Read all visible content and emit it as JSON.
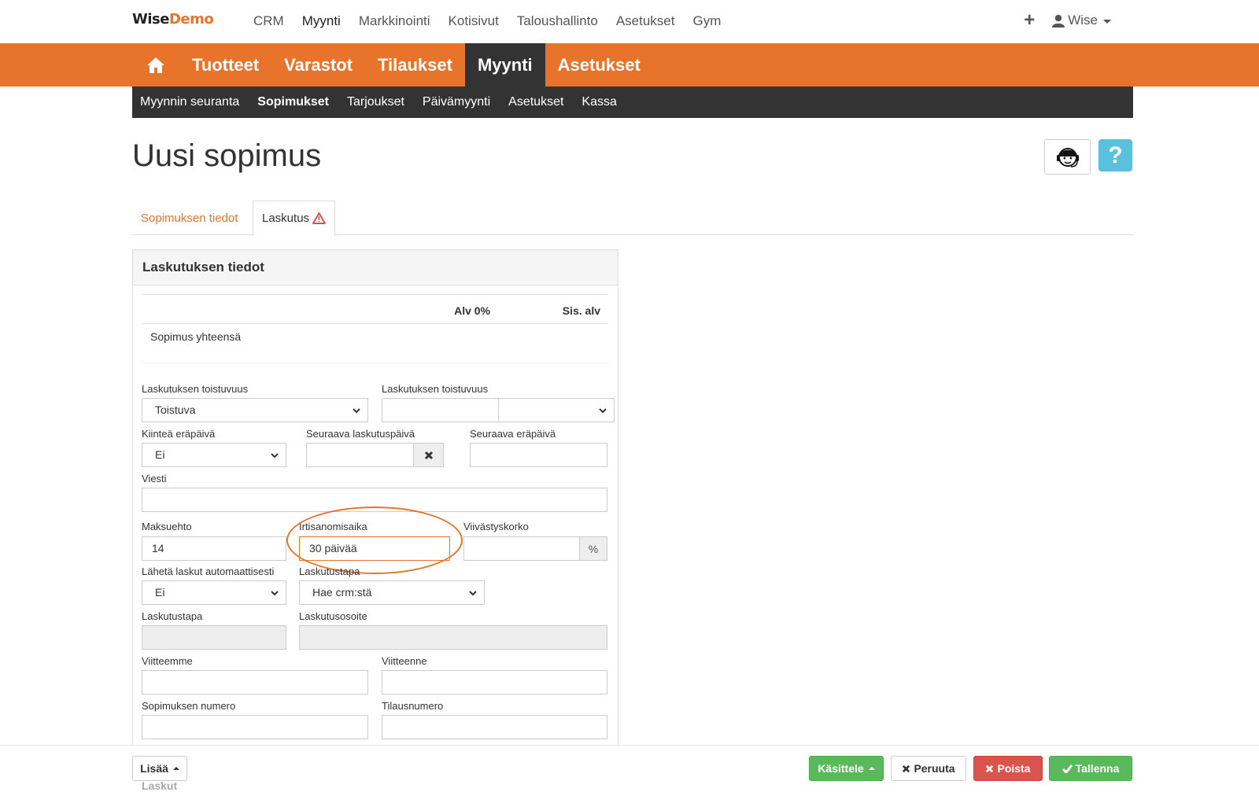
{
  "brand": {
    "part1": "Wise",
    "part2": "Demo",
    "accent": "#e8732b"
  },
  "top_nav": {
    "items": [
      {
        "label": "CRM"
      },
      {
        "label": "Myynti"
      },
      {
        "label": "Markkinointi"
      },
      {
        "label": "Kotisivut"
      },
      {
        "label": "Taloushallinto"
      },
      {
        "label": "Asetukset"
      },
      {
        "label": "Gym"
      }
    ],
    "active": "Myynti"
  },
  "user": {
    "name": "Wise",
    "icons": [
      "plus-icon",
      "user-icon",
      "chevron-down-icon"
    ]
  },
  "main_nav": {
    "items": [
      {
        "label": "Tuotteet"
      },
      {
        "label": "Varastot"
      },
      {
        "label": "Tilaukset"
      },
      {
        "label": "Myynti"
      },
      {
        "label": "Asetukset"
      }
    ],
    "active": "Myynti",
    "home_icon": "home-icon"
  },
  "sub_nav": {
    "items": [
      {
        "label": "Myynnin seuranta"
      },
      {
        "label": "Sopimukset"
      },
      {
        "label": "Tarjoukset"
      },
      {
        "label": "Päivämyynti"
      },
      {
        "label": "Asetukset"
      },
      {
        "label": "Kassa"
      }
    ],
    "active": "Sopimukset"
  },
  "page": {
    "title": "Uusi sopimus",
    "help": "?"
  },
  "tabs": [
    {
      "label": "Sopimuksen tiedot",
      "active": false
    },
    {
      "label": "Laskutus",
      "active": true,
      "warning_icon": "warning-icon"
    }
  ],
  "panel": {
    "title": "Laskutuksen tiedot",
    "summary": {
      "col_vat0": "Alv 0%",
      "col_incl_vat": "Sis. alv",
      "row_label": "Sopimus yhteensä"
    }
  },
  "form": {
    "billing_frequency": {
      "label": "Laskutuksen toistuvuus",
      "value": "Toistuva"
    },
    "billing_frequency2": {
      "label": "Laskutuksen toistuvuus",
      "value": "",
      "unit_value": ""
    },
    "fixed_due": {
      "label": "Kiinteä eräpäivä",
      "value": "Ei"
    },
    "next_billing_date": {
      "label": "Seuraava laskutuspäivä",
      "value": ""
    },
    "next_due_date": {
      "label": "Seuraava eräpäivä",
      "value": ""
    },
    "message": {
      "label": "Viesti",
      "value": ""
    },
    "payment_term": {
      "label": "Maksuehto",
      "value": "14"
    },
    "notice_period": {
      "label": "Irtisanomisaika",
      "value": "30 päivää"
    },
    "late_interest": {
      "label": "Viivästyskorko",
      "value": "",
      "unit": "%"
    },
    "auto_send": {
      "label": "Lähetä laskut automaattisesti",
      "value": "Ei"
    },
    "billing_method_select": {
      "label": "Laskutustapa",
      "value": "Hae crm:stä"
    },
    "billing_method": {
      "label": "Laskutustapa",
      "value": ""
    },
    "billing_address": {
      "label": "Laskutusosoite",
      "value": ""
    },
    "our_reference": {
      "label": "Viitteemme",
      "value": ""
    },
    "your_reference": {
      "label": "Viitteenne",
      "value": ""
    },
    "contract_number": {
      "label": "Sopimuksen numero",
      "value": ""
    },
    "order_number": {
      "label": "Tilausnumero",
      "value": ""
    }
  },
  "footer": {
    "more": "Lisää",
    "process": "Käsittele",
    "cancel": "Peruuta",
    "delete": "Poista",
    "save": "Tallenna",
    "cut_text": "Laskut",
    "colors": {
      "success": "#5cb85c",
      "danger": "#d9534f",
      "info": "#5bc0de"
    }
  }
}
